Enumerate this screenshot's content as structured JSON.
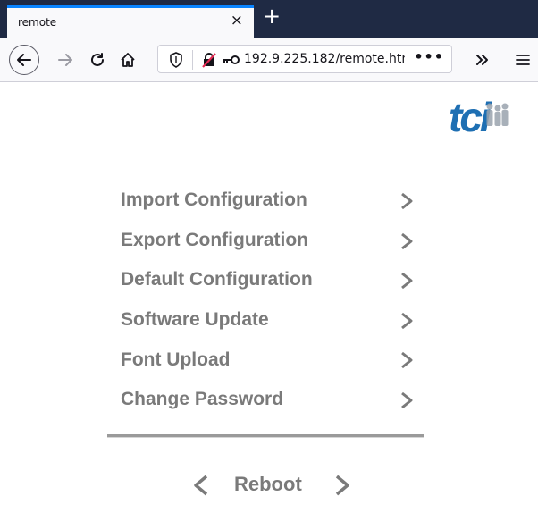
{
  "browser": {
    "tab_title": "remote",
    "tab_close": "×",
    "new_tab": "+",
    "url_host": "192.9.225.182",
    "url_path": "/remote.htm",
    "url_more": "•••",
    "overflow": "»",
    "menu_glyph": "≡"
  },
  "colors": {
    "accent_tab": "#0a84ff",
    "menu_text": "#7a7a7a",
    "logo_blue": "#1e6fb3"
  },
  "logo": {
    "text": "tci"
  },
  "menu": {
    "items": [
      {
        "label": "Import Configuration"
      },
      {
        "label": "Export Configuration"
      },
      {
        "label": "Default Configuration"
      },
      {
        "label": "Software Update"
      },
      {
        "label": "Font Upload"
      },
      {
        "label": "Change Password"
      }
    ]
  },
  "reboot": {
    "label": "Reboot"
  }
}
